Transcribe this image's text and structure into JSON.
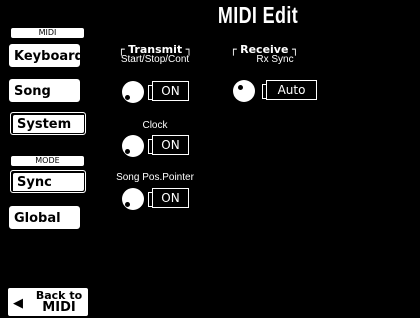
{
  "title": "MIDI Edit",
  "sidebar": {
    "midi_section": "MIDI",
    "mode_section": "MODE",
    "tabs": [
      "Keyboard",
      "Song",
      "System",
      "Sync",
      "Global"
    ],
    "active_midi_tab": "System",
    "active_mode_tab": "Sync"
  },
  "transmit": {
    "header": "Transmit",
    "items": [
      {
        "label": "Start/Stop/Cont",
        "value": "ON"
      },
      {
        "label": "Clock",
        "value": "ON"
      },
      {
        "label": "Song Pos.Pointer",
        "value": "ON"
      }
    ]
  },
  "receive": {
    "header": "Receive",
    "items": [
      {
        "label": "Rx Sync",
        "value": "Auto"
      }
    ]
  },
  "back_button": {
    "line1": "Back to",
    "line2": "MIDI",
    "icon": "left-arrow-icon"
  }
}
